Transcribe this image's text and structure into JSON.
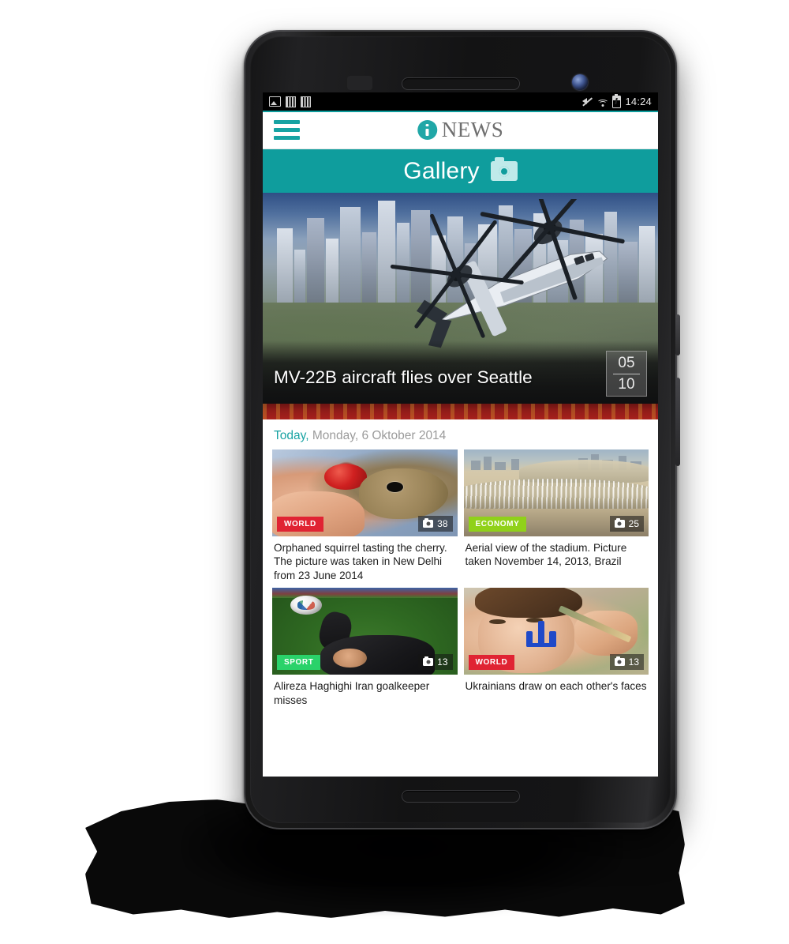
{
  "device": {
    "name": "android-phone-mockup",
    "frame_color": "#1a1a1c"
  },
  "statusbar": {
    "icons_left": [
      "photo-icon",
      "sim-bars-icon",
      "sim-bars-icon"
    ],
    "icons_right": [
      "mute-icon",
      "wifi-icon",
      "battery-icon"
    ],
    "time": "14:24"
  },
  "appbar": {
    "menu_icon": "hamburger-menu-icon",
    "brand_mark": "info-circle-icon",
    "brand_text": "NEWS",
    "accent_color": "#0c9c9c"
  },
  "section": {
    "title": "Gallery",
    "icon": "camera-icon",
    "background_color": "#0f9d9d"
  },
  "hero": {
    "caption": "MV-22B aircraft flies over Seattle",
    "counter_current": "05",
    "counter_total": "10",
    "image_alt": "MV-22B Osprey tiltrotor aircraft flying over a city skyline"
  },
  "date_row": {
    "today_label": "Today,",
    "date_text": "Monday, 6 Oktober 2014",
    "today_color": "#19a3a3"
  },
  "cards": [
    {
      "badge": "WORLD",
      "badge_color": "#e02333",
      "badge_class": "world",
      "photo_count": "38",
      "count_icon": "camera-icon",
      "caption": "Orphaned squirrel tasting the cherry. The picture was taken in New Delhi from 23 June 2014",
      "image_alt": "Baby squirrel eating a red cherry held in a hand"
    },
    {
      "badge": "ECONOMY",
      "badge_color": "#90d119",
      "badge_class": "economy",
      "photo_count": "25",
      "count_icon": "camera-icon",
      "caption": "Aerial view of the stadium. Picture taken November 14, 2013, Brazil",
      "image_alt": "Aerial view of a stadium under construction"
    },
    {
      "badge": "SPORT",
      "badge_color": "#2ad26a",
      "badge_class": "sport",
      "photo_count": "13",
      "count_icon": "camera-icon",
      "caption": "Alireza Haghighi Iran goalkeeper misses",
      "image_alt": "Goalkeeper diving for a football on a green pitch"
    },
    {
      "badge": "WORLD",
      "badge_color": "#e02333",
      "badge_class": "world",
      "photo_count": "13",
      "count_icon": "camera-icon",
      "caption": "Ukrainians draw on each other's faces",
      "image_alt": "Girl with a blue trident painted on her cheek"
    }
  ]
}
